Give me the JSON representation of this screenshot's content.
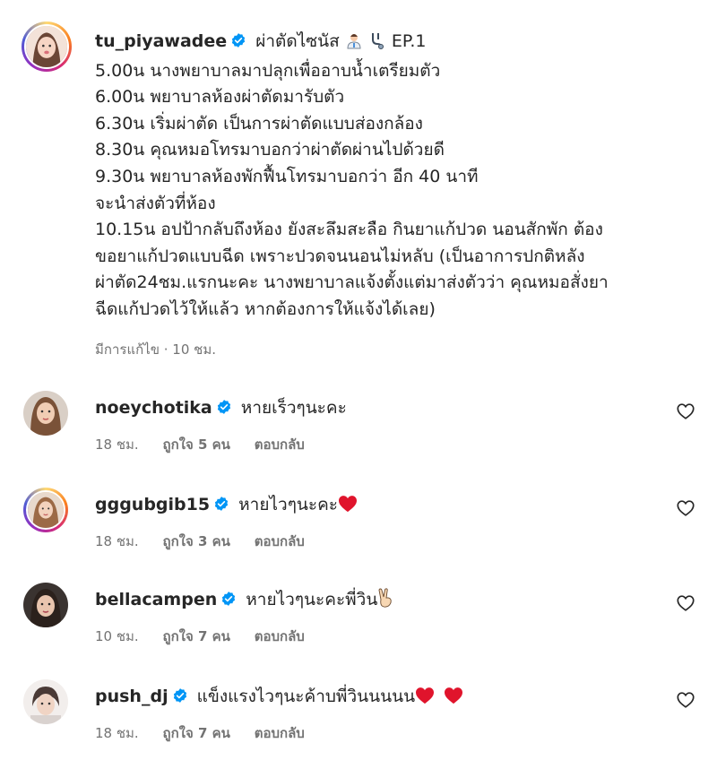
{
  "post": {
    "username": "tu_piyawadee",
    "title": "ผ่าตัดไซนัส",
    "title_suffix": "EP.1",
    "lines": [
      "5.00น นางพยาบาลมาปลุกเพื่ออาบน้ำเตรียมตัว",
      "6.00น พยาบาลห้องผ่าตัดมารับตัว",
      "6.30น เริ่มผ่าตัด เป็นการผ่าตัดแบบส่องกล้อง",
      "8.30น คุณหมอโทรมาบอกว่าผ่าตัดผ่านไปด้วยดี",
      "9.30น พยาบาลห้องพักฟื้นโทรมาบอกว่า อีก 40 นาที",
      "จะนำส่งตัวที่ห้อง",
      "10.15น อปป้ากลับถึงห้อง ยังสะลึมสะลือ กินยาแก้ปวด นอนสักพัก ต้อง",
      "ขอยาแก้ปวดแบบฉีด เพราะปวดจนนอนไม่หลับ (เป็นอาการปกติหลัง",
      "ผ่าตัด24ชม.แรกนะคะ นางพยาบาลแจ้งตั้งแต่มาส่งตัวว่า คุณหมอสั่งยา",
      "ฉีดแก้ปวดไว้ให้แล้ว หากต้องการให้แจ้งได้เลย)"
    ],
    "meta": "มีการแก้ไข · 10 ชม."
  },
  "comments": [
    {
      "username": "noeychotika",
      "text": "หายเร็วๆนะคะ",
      "emoji": "",
      "time": "18 ชม.",
      "likes": "ถูกใจ 5 คน",
      "reply": "ตอบกลับ",
      "ring": false
    },
    {
      "username": "gggubgib15",
      "text": "หายไวๆนะคะ",
      "emoji": "red-heart",
      "time": "18 ชม.",
      "likes": "ถูกใจ 3 คน",
      "reply": "ตอบกลับ",
      "ring": true
    },
    {
      "username": "bellacampen",
      "text": "หายไวๆนะคะพี่วิน",
      "emoji": "victory-hand",
      "time": "10 ชม.",
      "likes": "ถูกใจ 7 คน",
      "reply": "ตอบกลับ",
      "ring": false
    },
    {
      "username": "push_dj",
      "text": "แข็งแรงไวๆนะค้าบพี่วินนนนน",
      "emoji": "two-red-hearts",
      "time": "18 ชม.",
      "likes": "ถูกใจ 7 คน",
      "reply": "ตอบกลับ",
      "ring": false
    }
  ],
  "colors": {
    "verified": "#0095f6",
    "muted": "#737373",
    "heart": "#e0142c"
  }
}
